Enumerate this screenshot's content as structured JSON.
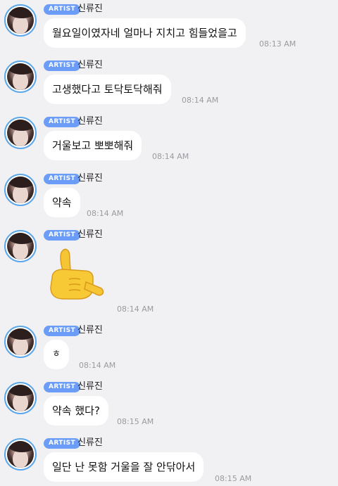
{
  "artist_badge": "ARTIST",
  "sender": "신류진",
  "messages": [
    {
      "text": "월요일이였자네 얼마나 지치고 힘들었을고",
      "time": "08:13 AM"
    },
    {
      "text": "고생했다고 토닥토닥해줘",
      "time": "08:14 AM"
    },
    {
      "text": "거울보고 뽀뽀해줘",
      "time": "08:14 AM"
    },
    {
      "text": "약속",
      "time": "08:14 AM"
    },
    {
      "text": "",
      "emoji": "call-me-hand-emoji",
      "time": "08:14 AM"
    },
    {
      "text": "ㅎ",
      "time": "08:14 AM"
    },
    {
      "text": "약속 했다?",
      "time": "08:15 AM"
    },
    {
      "text": "일단 난 못함 거울을 잘 안닦아서",
      "time": "08:15 AM"
    }
  ],
  "colors": {
    "background": "#f1f1f3",
    "badge": "#6b9cf7",
    "avatar_ring": "#5aa6ea",
    "bubble": "#ffffff",
    "timestamp": "#9b9ba0"
  }
}
